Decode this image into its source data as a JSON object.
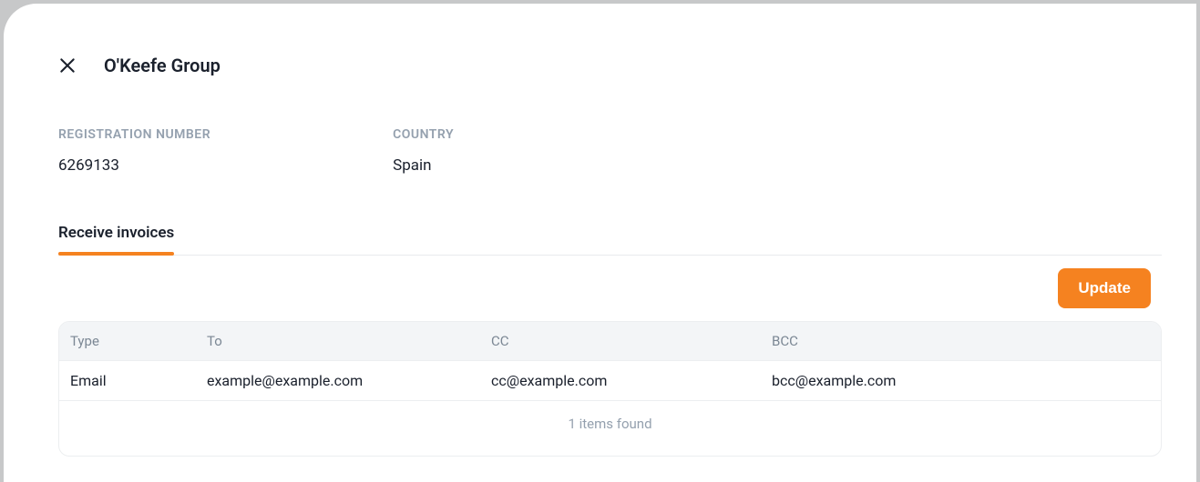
{
  "header": {
    "title": "O'Keefe Group"
  },
  "details": {
    "registration_label": "REGISTRATION NUMBER",
    "registration_value": "6269133",
    "country_label": "COUNTRY",
    "country_value": "Spain"
  },
  "tabs": {
    "receive_invoices": "Receive invoices"
  },
  "actions": {
    "update_label": "Update"
  },
  "table": {
    "headers": {
      "type": "Type",
      "to": "To",
      "cc": "CC",
      "bcc": "BCC"
    },
    "rows": [
      {
        "type": "Email",
        "to": "example@example.com",
        "cc": "cc@example.com",
        "bcc": "bcc@example.com"
      }
    ],
    "footer": "1 items found"
  }
}
